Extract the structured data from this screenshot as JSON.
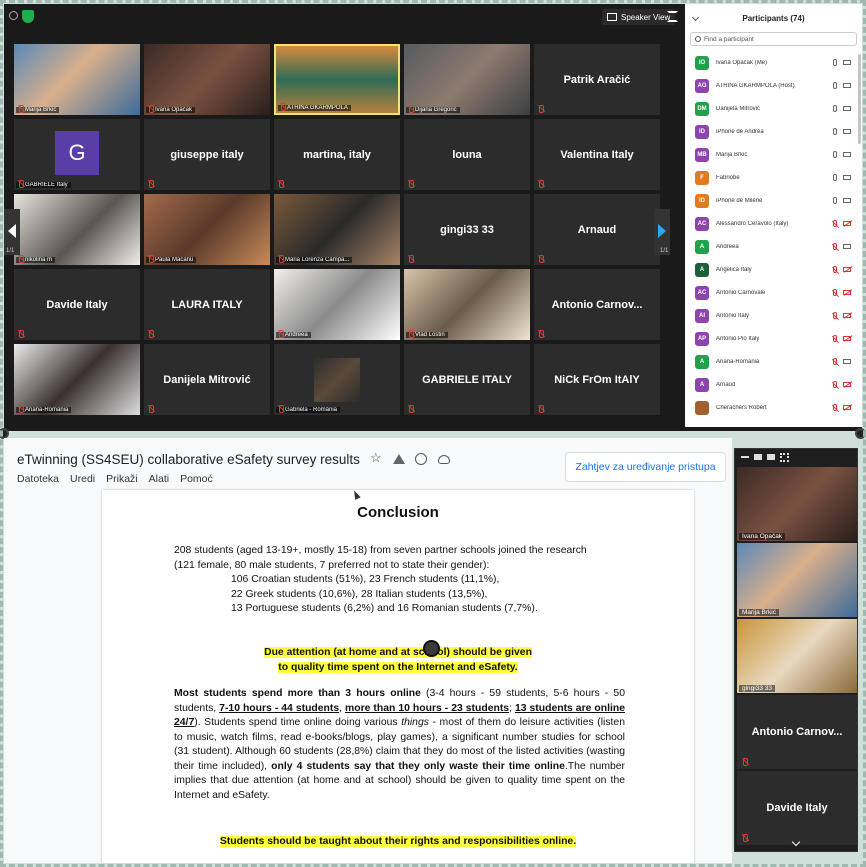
{
  "zoom": {
    "speaker_view_label": "Speaker View",
    "page_indicator_left": "1/1",
    "page_indicator_right": "1/1",
    "tiles": [
      {
        "label": "Marija Brkić",
        "type": "video",
        "name": ""
      },
      {
        "label": "Ivana Opačak",
        "type": "video",
        "name": ""
      },
      {
        "label": "ATHINA GKARMPOLA",
        "type": "video",
        "name": "",
        "active": true
      },
      {
        "label": "Dijana Gregorić",
        "type": "video",
        "name": ""
      },
      {
        "label": "",
        "type": "name",
        "name": "Patrik Aračić"
      },
      {
        "label": "GABRIELE Italy",
        "type": "avatar",
        "name": "",
        "avatar_letter": "G"
      },
      {
        "label": "",
        "type": "name",
        "name": "giuseppe italy"
      },
      {
        "label": "",
        "type": "name",
        "name": "martina, italy"
      },
      {
        "label": "",
        "type": "name",
        "name": "louna"
      },
      {
        "label": "",
        "type": "name",
        "name": "Valentina Italy"
      },
      {
        "label": "nikolina m",
        "type": "video",
        "name": ""
      },
      {
        "label": "Paula Macanu",
        "type": "video",
        "name": ""
      },
      {
        "label": "Maria Lorenza Campa...",
        "type": "video",
        "name": ""
      },
      {
        "label": "",
        "type": "name",
        "name": "gingi33 33"
      },
      {
        "label": "",
        "type": "name",
        "name": "Arnaud"
      },
      {
        "label": "",
        "type": "name",
        "name": "Davide Italy"
      },
      {
        "label": "",
        "type": "name",
        "name": "LAURA ITALY"
      },
      {
        "label": "Andreea",
        "type": "video",
        "name": ""
      },
      {
        "label": "Vlad Lostin",
        "type": "video",
        "name": ""
      },
      {
        "label": "",
        "type": "name",
        "name": "Antonio Carnov..."
      },
      {
        "label": "Ariana-Romania",
        "type": "video",
        "name": ""
      },
      {
        "label": "",
        "type": "name",
        "name": "Danijela Mitrović"
      },
      {
        "label": "Gabriela - România",
        "type": "video",
        "name": ""
      },
      {
        "label": "",
        "type": "name",
        "name": "GABRIELE ITALY"
      },
      {
        "label": "",
        "type": "name",
        "name": "NiCk FrOm ItAlY"
      }
    ]
  },
  "participants": {
    "title": "Participants (74)",
    "search_placeholder": "Find a participant",
    "list": [
      {
        "initials": "IO",
        "name": "Ivana Opačak (Me)",
        "color": "#22a04b",
        "mic_off": false,
        "cam_off": false
      },
      {
        "initials": "AG",
        "name": "ATHINA GKARMPOLA (Host)",
        "color": "#8e44ad",
        "mic_off": false,
        "cam_off": false
      },
      {
        "initials": "DM",
        "name": "Danijela Mitrović",
        "color": "#22a04b",
        "mic_off": false,
        "cam_off": false
      },
      {
        "initials": "ID",
        "name": "iPhone de Andréa",
        "color": "#8e44ad",
        "mic_off": false,
        "cam_off": false
      },
      {
        "initials": "MB",
        "name": "Marija Brkić",
        "color": "#8e44ad",
        "mic_off": false,
        "cam_off": false
      },
      {
        "initials": "F",
        "name": "Fabriobe",
        "color": "#e07b22",
        "mic_off": false,
        "cam_off": false
      },
      {
        "initials": "ID",
        "name": "iPhone de Milène",
        "color": "#e07b22",
        "mic_off": false,
        "cam_off": false
      },
      {
        "initials": "AC",
        "name": "Alessandro Ceravolo (Italy)",
        "color": "#8e44ad",
        "mic_off": true,
        "cam_off": true
      },
      {
        "initials": "A",
        "name": "Andreea",
        "color": "#22a04b",
        "mic_off": true,
        "cam_off": false
      },
      {
        "initials": "A",
        "name": "Angelica Italy",
        "color": "#1e5e3a",
        "mic_off": true,
        "cam_off": true
      },
      {
        "initials": "AC",
        "name": "Antonio Carnovale",
        "color": "#8e44ad",
        "mic_off": true,
        "cam_off": true
      },
      {
        "initials": "AI",
        "name": "Antonio Italy",
        "color": "#8e44ad",
        "mic_off": true,
        "cam_off": true
      },
      {
        "initials": "AP",
        "name": "Antonio Pio Italy",
        "color": "#8e44ad",
        "mic_off": true,
        "cam_off": true
      },
      {
        "initials": "A",
        "name": "Ariana-Romania",
        "color": "#22a04b",
        "mic_off": true,
        "cam_off": false
      },
      {
        "initials": "A",
        "name": "Arnaud",
        "color": "#8e44ad",
        "mic_off": true,
        "cam_off": true
      },
      {
        "initials": "",
        "name": "Cherachers Robert",
        "color": "#a06030",
        "mic_off": true,
        "cam_off": true
      }
    ]
  },
  "docs": {
    "title": "eTwinning (SS4SEU) collaborative eSafety survey results",
    "request_button": "Zahtjev za uređivanje pristupa",
    "menu": [
      "Datoteka",
      "Uredi",
      "Prikaži",
      "Alati",
      "Pomoć"
    ],
    "heading": "Conclusion",
    "para1_line1": "208 students (aged 13-19+, mostly 15-18) from seven partner schools joined the research",
    "para1_line2": "(121 female, 80 male students, 7 preferred not to state their gender):",
    "para1_line3": "106 Croatian students (51%), 23 French students (11,1%),",
    "para1_line4": "22 Greek students (10,6%), 28 Italian students (13,5%),",
    "para1_line5": "13 Portuguese students (6,2%) and 16 Romanian students (7,7%).",
    "highlight1_line1": "Due attention (at home and at school) should be given",
    "highlight1_line2": "to quality time spent on the Internet and eSafety.",
    "para2_a": "Most students spend more than 3 hours online",
    "para2_b": " (3-4 hours - 59 students, 5-6 hours - 50 students, ",
    "para2_c": "7-10 hours - 44 students",
    "para2_d": ", ",
    "para2_e": "more than 10 hours - 23 students",
    "para2_f": "; ",
    "para2_g": "13 students are online 24/7",
    "para2_h": "). Students spend time online doing various ",
    "para2_i": "things",
    "para2_j": " - most of them do leisure activities (listen to music, watch films, read e-books/blogs, play games), a significant number studies for school (31 student). Although 60 students (28,8%) claim that they do most of the listed activities (wasting their time included), ",
    "para2_k": "only 4 students say that they only waste their time online",
    "para2_l": ".The number implies that due attention (at home and at school) should be given to quality time spent on the Internet and eSafety.",
    "highlight2": "Students should be taught about their rights and responsibilities online."
  },
  "strip": {
    "tiles": [
      {
        "label": "Ivana Opačak",
        "type": "video",
        "name": ""
      },
      {
        "label": "Marija Brkić",
        "type": "video",
        "name": ""
      },
      {
        "label": "gingi33 33",
        "type": "video",
        "name": ""
      },
      {
        "label": "",
        "type": "name",
        "name": "Antonio Carnov..."
      },
      {
        "label": "",
        "type": "name",
        "name": "Davide Italy"
      }
    ]
  }
}
